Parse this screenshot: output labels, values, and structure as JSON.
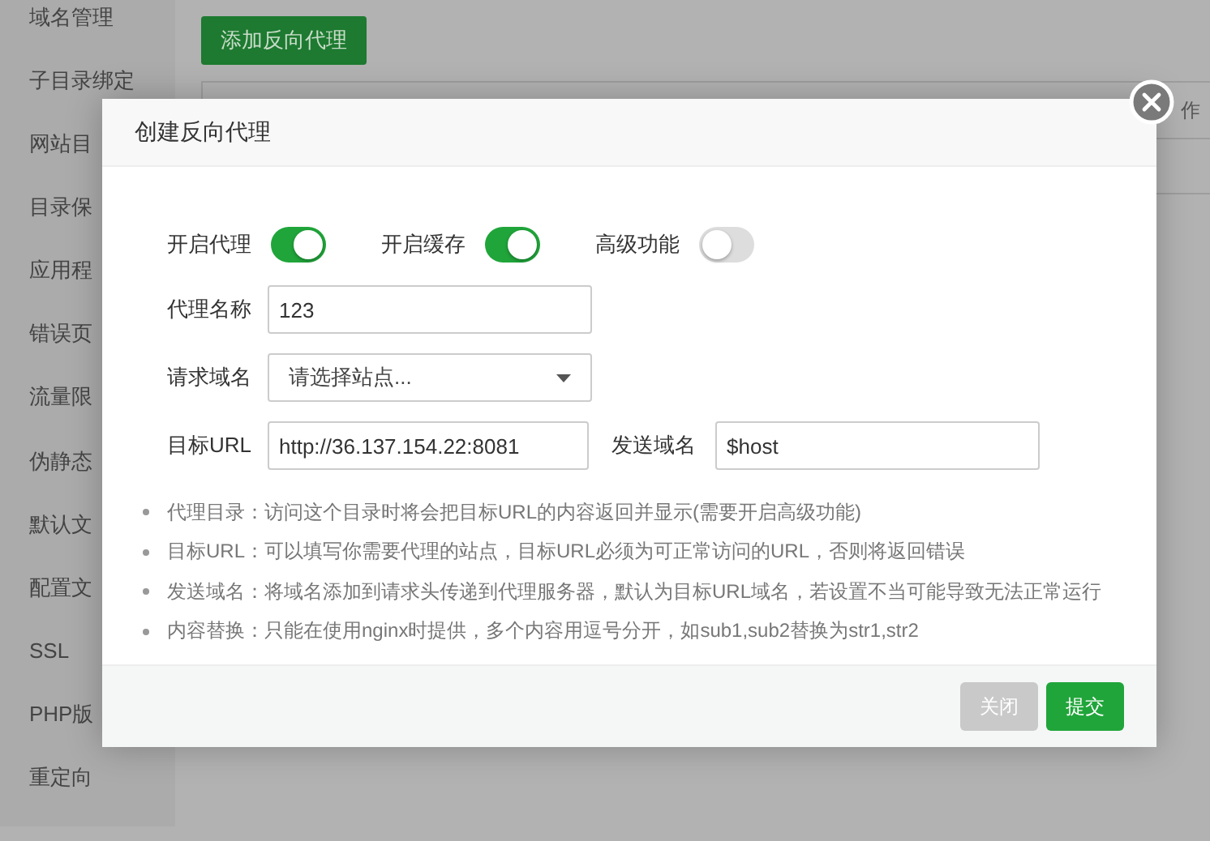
{
  "sidebar": {
    "items": [
      {
        "label": "域名管理"
      },
      {
        "label": "子目录绑定"
      },
      {
        "label": "网站目"
      },
      {
        "label": "目录保"
      },
      {
        "label": "应用程"
      },
      {
        "label": "错误页"
      },
      {
        "label": "流量限"
      },
      {
        "label": "伪静态"
      },
      {
        "label": "默认文"
      },
      {
        "label": "配置文"
      },
      {
        "label": "SSL"
      },
      {
        "label": "PHP版"
      },
      {
        "label": "重定向"
      }
    ]
  },
  "add_button": "添加反向代理",
  "table": {
    "columns": [
      "作"
    ]
  },
  "modal": {
    "title": "创建反向代理",
    "toggles": [
      {
        "label": "开启代理",
        "on": true
      },
      {
        "label": "开启缓存",
        "on": true
      },
      {
        "label": "高级功能",
        "on": false
      }
    ],
    "name_field": {
      "label": "代理名称",
      "value": "123"
    },
    "domain_select": {
      "label": "请求域名",
      "placeholder": "请选择站点..."
    },
    "target_field": {
      "label": "目标URL",
      "value": "http://36.137.154.22:8081"
    },
    "host_field": {
      "label": "发送域名",
      "value": "$host"
    },
    "notes": [
      "代理目录：访问这个目录时将会把目标URL的内容返回并显示(需要开启高级功能)",
      "目标URL：可以填写你需要代理的站点，目标URL必须为可正常访问的URL，否则将返回错误",
      "发送域名：将域名添加到请求头传递到代理服务器，默认为目标URL域名，若设置不当可能导致无法正常运行",
      "内容替换：只能在使用nginx时提供，多个内容用逗号分开，如sub1,sub2替换为str1,str2"
    ],
    "buttons": [
      {
        "label": "关闭",
        "kind": "secondary"
      },
      {
        "label": "提交",
        "kind": "primary"
      }
    ]
  }
}
